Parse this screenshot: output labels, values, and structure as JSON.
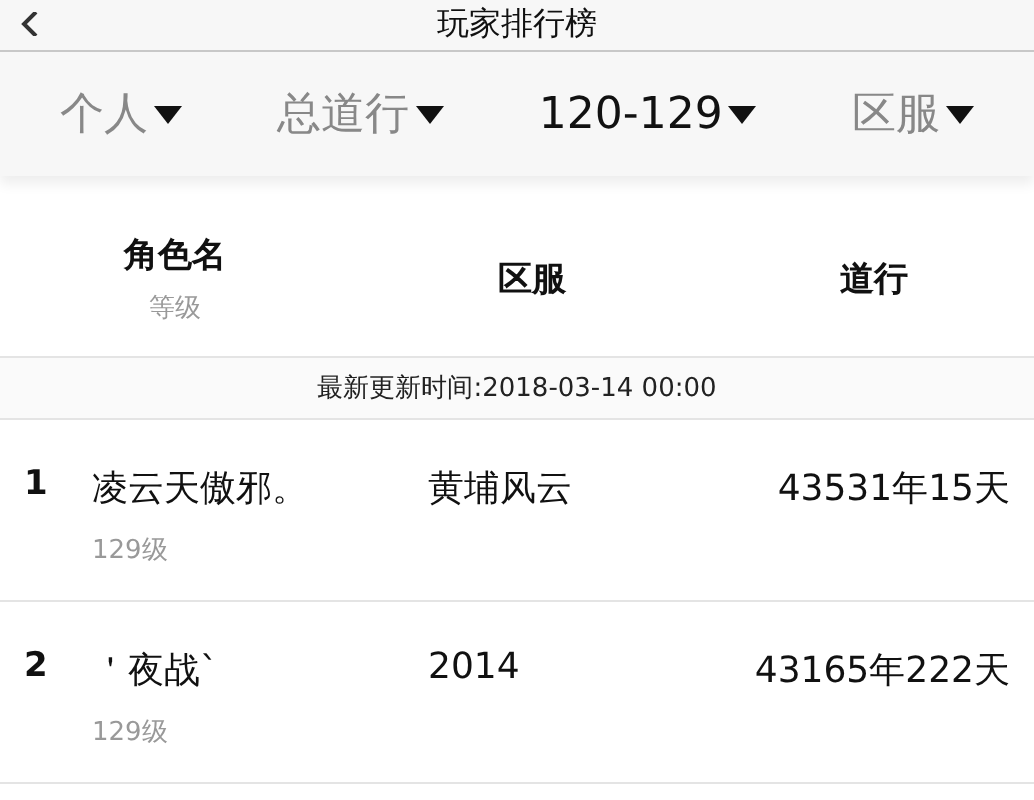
{
  "header": {
    "title": "玩家排行榜"
  },
  "filters": [
    {
      "label": "个人",
      "selected": false
    },
    {
      "label": "总道行",
      "selected": false
    },
    {
      "label": "120-129",
      "selected": true
    },
    {
      "label": "区服",
      "selected": false
    }
  ],
  "table": {
    "columns": [
      {
        "label": "角色名",
        "sublabel": "等级"
      },
      {
        "label": "区服"
      },
      {
        "label": "道行"
      }
    ],
    "updated": "最新更新时间:2018-03-14 00:00",
    "rows": [
      {
        "rank": "1",
        "name": "凌云天傲邪。",
        "level": "129级",
        "server": "黄埔风云",
        "value": "43531年15天"
      },
      {
        "rank": "2",
        "name": "＇夜战ˋ",
        "level": "129级",
        "server": "2014",
        "value": "43165年222天"
      }
    ]
  }
}
